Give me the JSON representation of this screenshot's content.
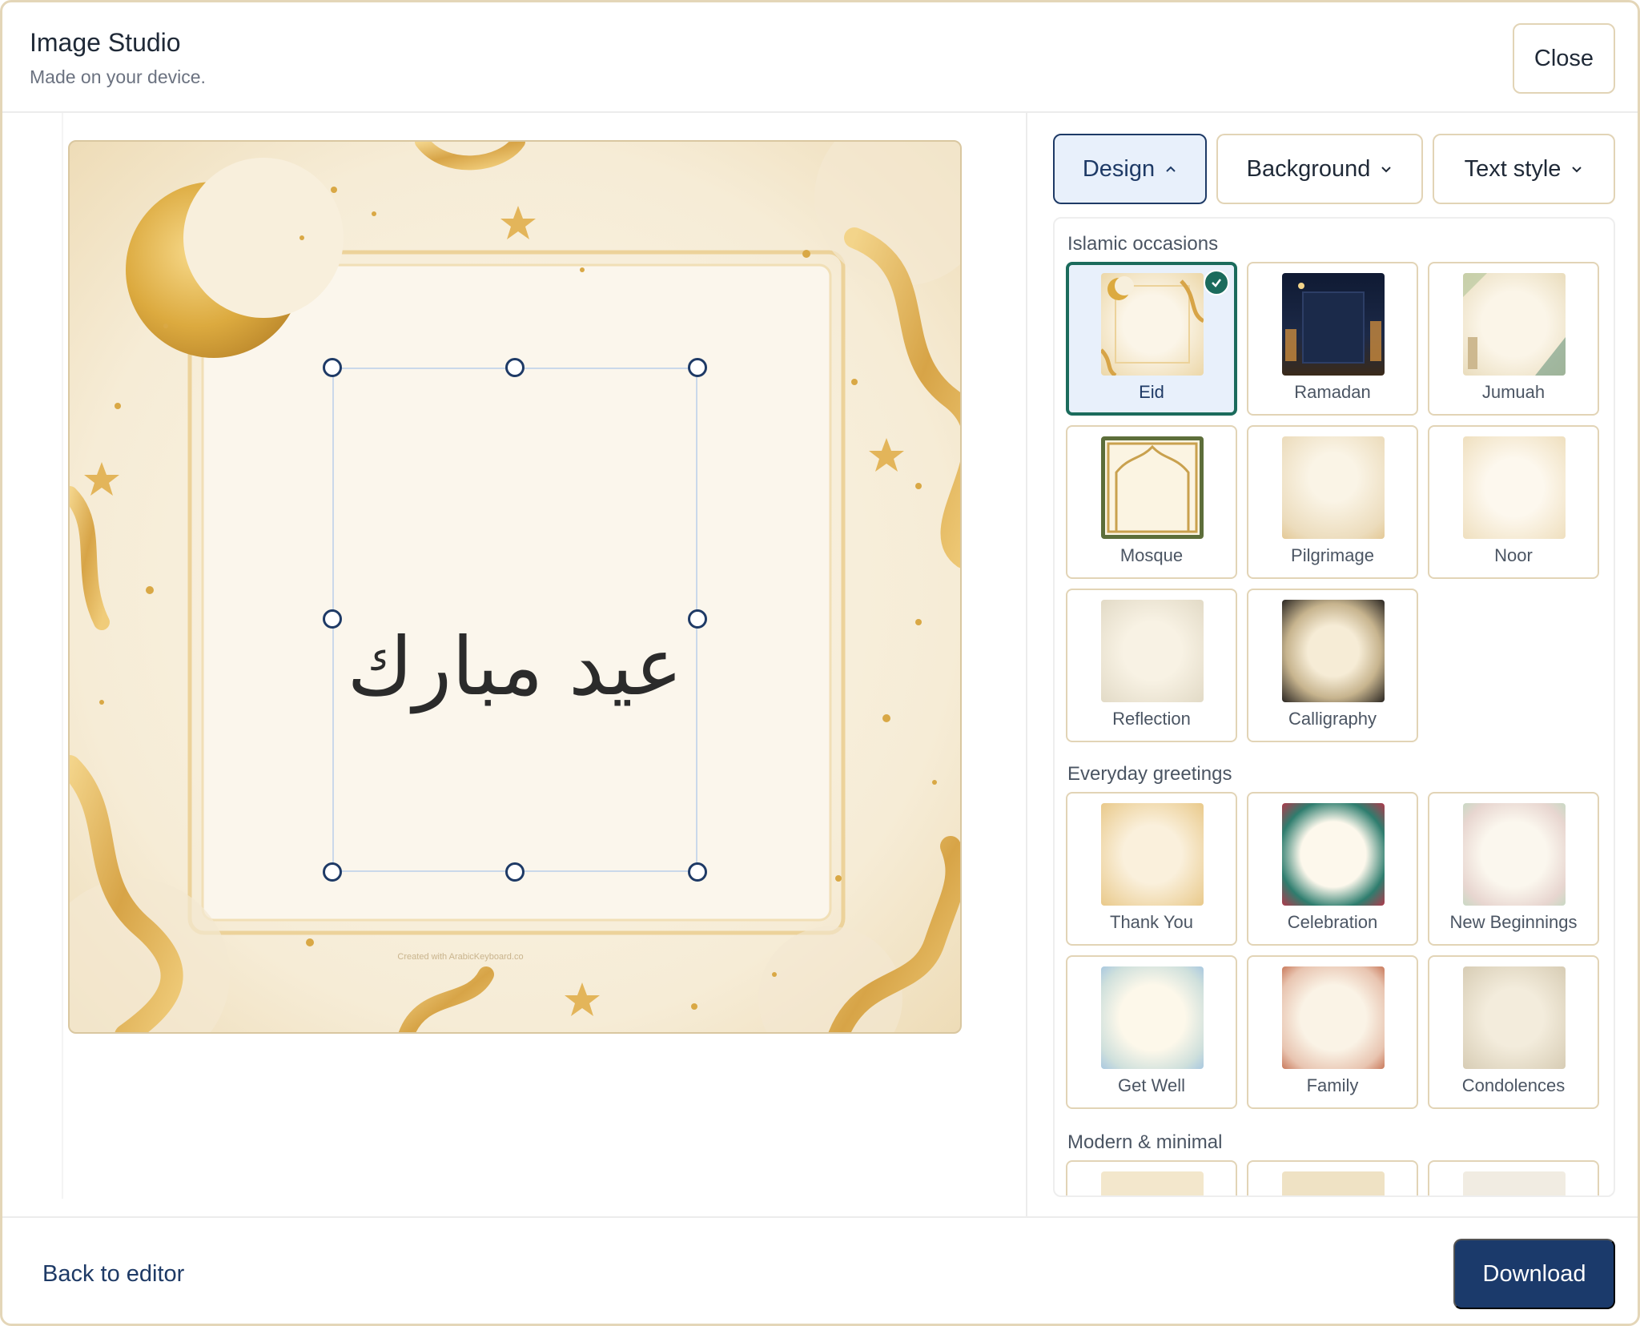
{
  "header": {
    "title": "Image Studio",
    "subtitle": "Made on your device.",
    "close_label": "Close"
  },
  "canvas": {
    "text": "عيد مبارك",
    "watermark": "Created with ArabicKeyboard.co"
  },
  "tabs": [
    {
      "label": "Design",
      "state": "expanded",
      "active": true
    },
    {
      "label": "Background",
      "state": "collapsed",
      "active": false
    },
    {
      "label": "Text style",
      "state": "collapsed",
      "active": false
    }
  ],
  "panel": {
    "sections": [
      {
        "title": "Islamic occasions",
        "items": [
          {
            "label": "Eid",
            "selected": true,
            "theme": "eid"
          },
          {
            "label": "Ramadan",
            "selected": false,
            "theme": "ramadan"
          },
          {
            "label": "Jumuah",
            "selected": false,
            "theme": "jumuah"
          },
          {
            "label": "Mosque",
            "selected": false,
            "theme": "mosque"
          },
          {
            "label": "Pilgrimage",
            "selected": false,
            "theme": "pilgrimage"
          },
          {
            "label": "Noor",
            "selected": false,
            "theme": "noor"
          },
          {
            "label": "Reflection",
            "selected": false,
            "theme": "reflection"
          },
          {
            "label": "Calligraphy",
            "selected": false,
            "theme": "calligraphy"
          }
        ]
      },
      {
        "title": "Everyday greetings",
        "items": [
          {
            "label": "Thank You",
            "selected": false,
            "theme": "thankyou"
          },
          {
            "label": "Celebration",
            "selected": false,
            "theme": "celebration"
          },
          {
            "label": "New Beginnings",
            "selected": false,
            "theme": "newbeginnings"
          },
          {
            "label": "Get Well",
            "selected": false,
            "theme": "getwell"
          },
          {
            "label": "Family",
            "selected": false,
            "theme": "family"
          },
          {
            "label": "Condolences",
            "selected": false,
            "theme": "condolences"
          }
        ]
      },
      {
        "title": "Modern & minimal",
        "items": [
          {
            "label": "",
            "selected": false,
            "theme": "modern1"
          },
          {
            "label": "",
            "selected": false,
            "theme": "modern2"
          },
          {
            "label": "",
            "selected": false,
            "theme": "modern3"
          }
        ]
      }
    ]
  },
  "footer": {
    "back_label": "Back to editor",
    "download_label": "Download"
  },
  "colors": {
    "accent": "#1b3a6b",
    "selected_border": "#1b6b5c",
    "card_border": "#e2d4b6",
    "gold": "#d9a845"
  },
  "icons": {
    "tab_design": "chevron-up-icon",
    "tab_background": "chevron-down-icon",
    "tab_text_style": "chevron-down-icon",
    "selected_card": "check-circle-icon"
  }
}
